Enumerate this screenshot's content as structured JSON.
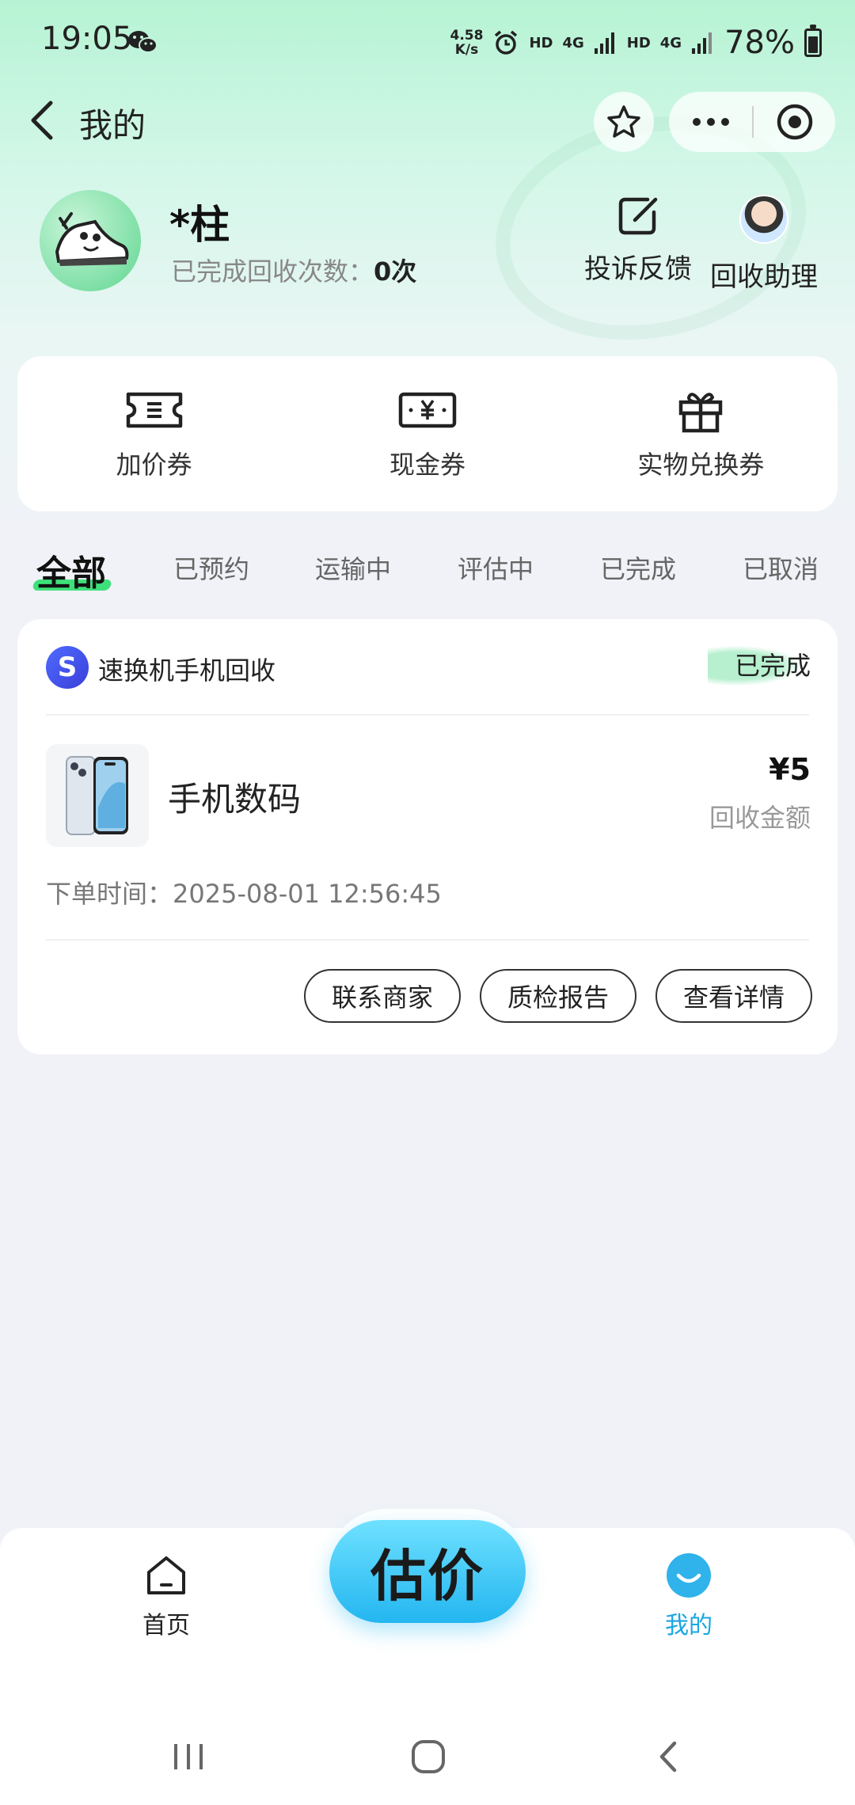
{
  "status_bar": {
    "time": "19:05",
    "speed_value": "4.58",
    "speed_unit": "K/s",
    "hd1": "HD",
    "net1": "4G",
    "hd2": "HD",
    "net2": "4G",
    "battery": "78%"
  },
  "header": {
    "title": "我的",
    "icons": [
      "back-icon",
      "star-icon",
      "more-icon",
      "target-icon"
    ]
  },
  "profile": {
    "username": "*柱",
    "recycle_count_label": "已完成回收次数：",
    "recycle_count_value": "0次",
    "feedback_label": "投诉反馈",
    "assistant_label": "回收助理"
  },
  "coupons": [
    {
      "label": "加价券",
      "icon": "ticket-icon"
    },
    {
      "label": "现金券",
      "icon": "cash-coupon-icon"
    },
    {
      "label": "实物兑换券",
      "icon": "gift-icon"
    }
  ],
  "tabs": [
    "全部",
    "已预约",
    "运输中",
    "评估中",
    "已完成",
    "已取消"
  ],
  "order": {
    "merchant_logo_letter": "S",
    "merchant": "速换机手机回收",
    "status": "已完成",
    "product": "手机数码",
    "amount": "¥5",
    "amount_label": "回收金额",
    "time_label": "下单时间：",
    "time": "2025-08-01 12:56:45",
    "buttons": [
      "联系商家",
      "质检报告",
      "查看详情"
    ]
  },
  "bottom_nav": {
    "home": "首页",
    "estimate": "估价",
    "mine": "我的",
    "accent_color": "#1aa6e0"
  }
}
